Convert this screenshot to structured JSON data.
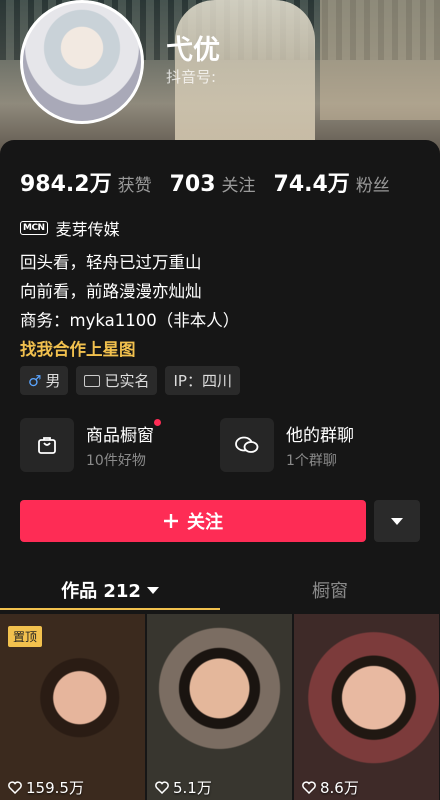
{
  "profile": {
    "name": "弋优",
    "douyin_id_label": "抖音号:"
  },
  "stats": [
    {
      "value": "984.2万",
      "label": "获赞"
    },
    {
      "value": "703",
      "label": "关注"
    },
    {
      "value": "74.4万",
      "label": "粉丝"
    }
  ],
  "org": {
    "badge": "MCN",
    "name": "麦芽传媒"
  },
  "bio": {
    "lines": [
      "回头看，轻舟已过万重山",
      "向前看，前路漫漫亦灿灿",
      "商务：myka1100（非本人）"
    ],
    "link": "找我合作上星图"
  },
  "tags": {
    "gender_symbol": "♂",
    "gender": "男",
    "verified": "已实名",
    "location": "IP：四川"
  },
  "services": [
    {
      "title": "商品橱窗",
      "subtitle": "10件好物",
      "icon": "bag-icon"
    },
    {
      "title": "他的群聊",
      "subtitle": "1个群聊",
      "icon": "chat-icon"
    }
  ],
  "follow_button": {
    "label": "关注",
    "icon": "plus-icon"
  },
  "tabs": [
    {
      "label": "作品 212"
    },
    {
      "label": "橱窗"
    }
  ],
  "videos": [
    {
      "likes": "159.5万",
      "pinned": "置顶"
    },
    {
      "likes": "5.1万"
    },
    {
      "likes": "8.6万"
    }
  ],
  "colors": {
    "accent": "#fe2c55",
    "highlight": "#f2c14e",
    "background": "#161616"
  }
}
